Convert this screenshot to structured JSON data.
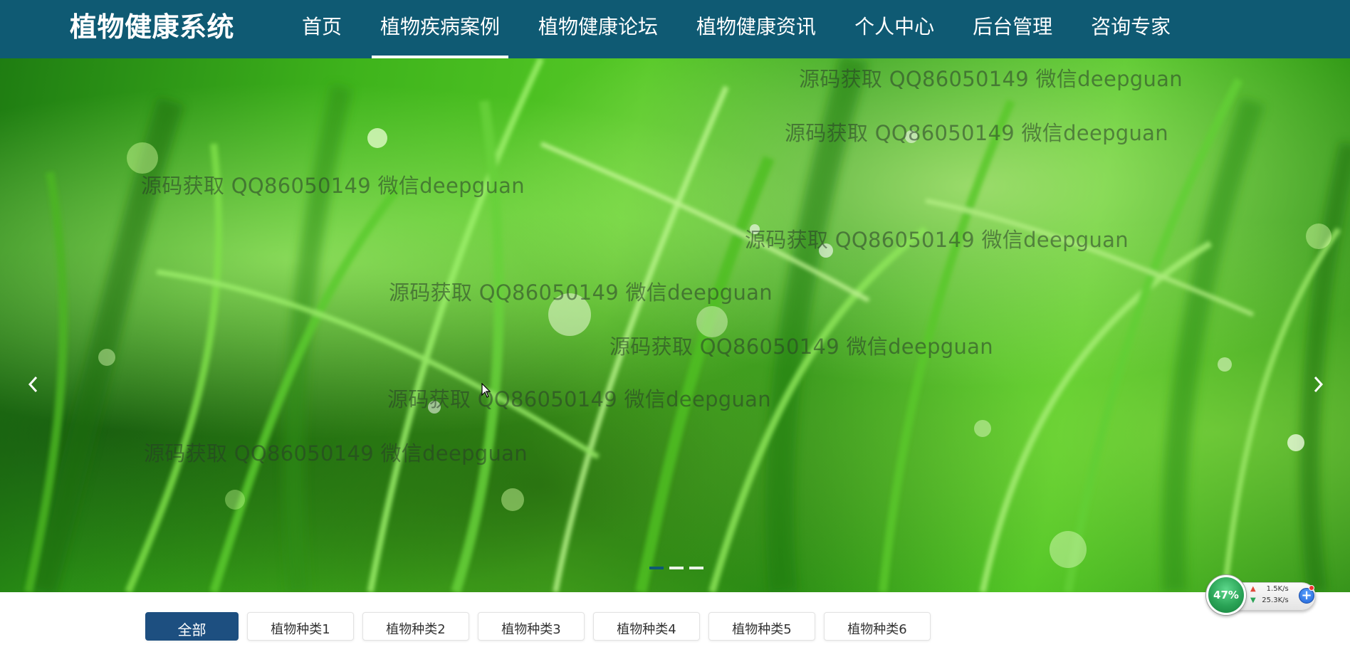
{
  "header": {
    "brand": "植物健康系统",
    "nav": [
      {
        "label": "首页",
        "active": false
      },
      {
        "label": "植物疾病案例",
        "active": true
      },
      {
        "label": "植物健康论坛",
        "active": false
      },
      {
        "label": "植物健康资讯",
        "active": false
      },
      {
        "label": "个人中心",
        "active": false
      },
      {
        "label": "后台管理",
        "active": false
      },
      {
        "label": "咨询专家",
        "active": false
      }
    ],
    "background_color": "#0f5a73"
  },
  "carousel": {
    "watermark_text": "源码获取 QQ86050149 微信deepguan",
    "prev_icon": "chevron-left-icon",
    "next_icon": "chevron-right-icon",
    "slide_count": 3,
    "active_slide": 1
  },
  "category_tabs": [
    {
      "label": "全部",
      "active": true
    },
    {
      "label": "植物种类1",
      "active": false
    },
    {
      "label": "植物种类2",
      "active": false
    },
    {
      "label": "植物种类3",
      "active": false
    },
    {
      "label": "植物种类4",
      "active": false
    },
    {
      "label": "植物种类5",
      "active": false
    },
    {
      "label": "植物种类6",
      "active": false
    }
  ],
  "net_widget": {
    "percent": "47%",
    "upload": "1.5K/s",
    "download": "25.3K/s",
    "add_icon": "plus-icon"
  },
  "colors": {
    "accent_tab": "#1d4f80",
    "gauge": "#2aa356"
  }
}
